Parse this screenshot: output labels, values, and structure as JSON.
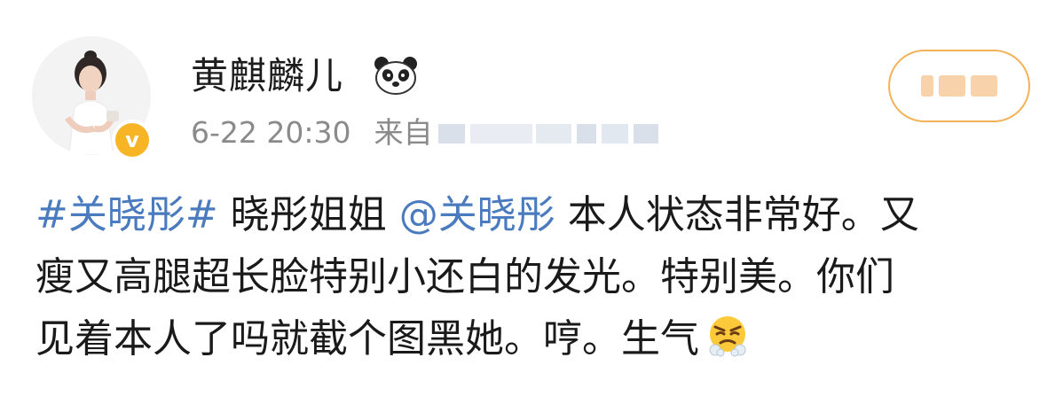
{
  "user": {
    "name": "黄麒麟儿",
    "verified_mark": "v",
    "badge_icon": "panda-icon",
    "avatar_icon": "avatar-photo"
  },
  "meta": {
    "time": "6-22 20:30",
    "source_label": "来自"
  },
  "follow_button": {
    "label": "+关注",
    "border_color": "#f3b257"
  },
  "post": {
    "hashtag": "#关晓彤#",
    "text_1": " 晓彤姐姐 ",
    "mention": "@关晓彤",
    "text_2": " 本人状态非常好。又",
    "line_2": "瘦又高腿超长脸特别小还白的发光。特别美。你们",
    "line_3": "见着本人了吗就截个图黑她。哼。生气",
    "emoji": "angry-face-icon",
    "link_color": "#4a7bbf"
  }
}
